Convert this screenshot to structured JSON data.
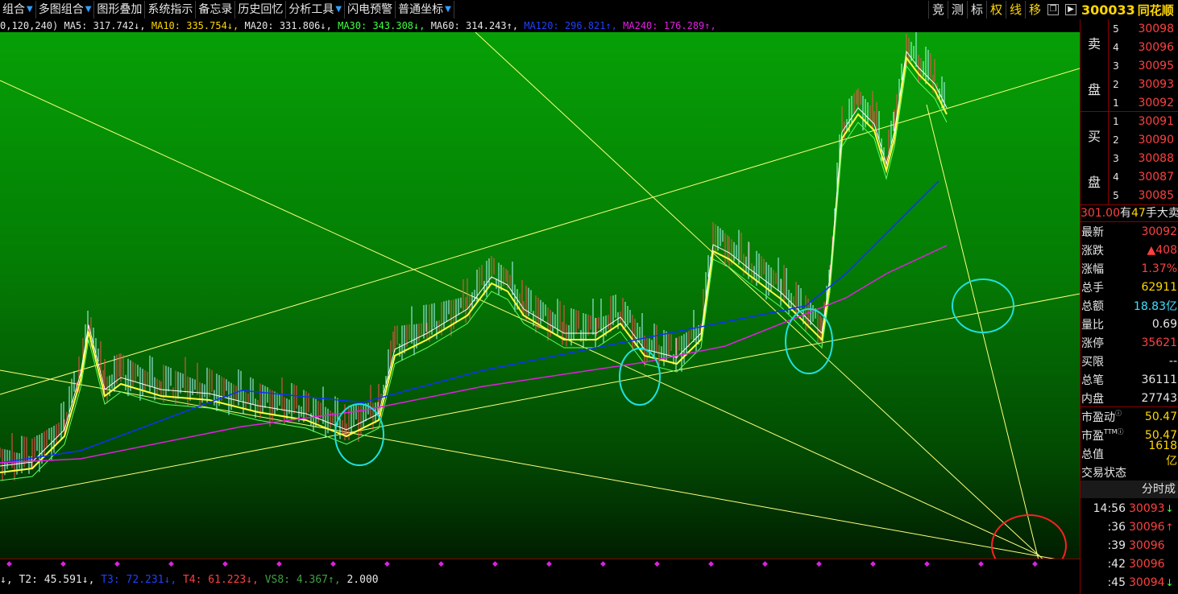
{
  "toolbar": {
    "items": [
      {
        "label": "组合",
        "arrow": "▼"
      },
      {
        "label": "多图组合",
        "arrow": "▼"
      },
      {
        "label": "图形叠加",
        "arrow": ""
      },
      {
        "label": "系统指示",
        "arrow": ""
      },
      {
        "label": "备忘录",
        "arrow": ""
      },
      {
        "label": "历史回忆",
        "arrow": ""
      },
      {
        "label": "分析工具",
        "arrow": "▼"
      },
      {
        "label": "闪电预警",
        "arrow": ""
      },
      {
        "label": "普通坐标",
        "arrow": "▼"
      }
    ],
    "right": [
      "竞",
      "测",
      "标",
      "权",
      "线",
      "移"
    ]
  },
  "stock": {
    "code": "300033",
    "name": "同花顺"
  },
  "ma_bar": {
    "prefix": "0,120,240)",
    "ma5": "MA5: 317.742↓,",
    "ma10": "MA10: 335.754↓,",
    "ma20": "MA20: 331.806↓,",
    "ma30": "MA30: 343.308↓,",
    "ma60": "MA60: 314.243↑,",
    "ma120": "MA120: 296.821↑,",
    "ma240": "MA240: 176.289↑,"
  },
  "indicator_bar": {
    "t1": "↓,",
    "t2": "T2: 45.591↓,",
    "t3": "T3: 72.231↓,",
    "t4": "T4: 61.223↓,",
    "vs8": "VS8: 4.367↑,",
    "v": "2.000"
  },
  "orderbook": {
    "sell_label": [
      "卖",
      "盘"
    ],
    "buy_label": [
      "买",
      "盘"
    ],
    "sell": [
      {
        "level": "5",
        "price": "30098"
      },
      {
        "level": "4",
        "price": "30096"
      },
      {
        "level": "3",
        "price": "30095"
      },
      {
        "level": "2",
        "price": "30093"
      },
      {
        "level": "1",
        "price": "30092"
      }
    ],
    "buy": [
      {
        "level": "1",
        "price": "30091"
      },
      {
        "level": "2",
        "price": "30090"
      },
      {
        "level": "3",
        "price": "30088"
      },
      {
        "level": "4",
        "price": "30087"
      },
      {
        "level": "5",
        "price": "30085"
      }
    ]
  },
  "message": {
    "price": "301.00",
    "text1": "有",
    "qty": "47",
    "text2": "手大卖"
  },
  "stats": [
    {
      "label": "最新",
      "value": "30092",
      "color": "red"
    },
    {
      "label": "涨跌",
      "value": "▲408",
      "color": "red"
    },
    {
      "label": "涨幅",
      "value": "1.37%",
      "color": "red"
    },
    {
      "label": "总手",
      "value": "62911",
      "color": "yel"
    },
    {
      "label": "总额",
      "value": "18.83亿",
      "color": "cyn"
    },
    {
      "label": "量比",
      "value": "0.69",
      "color": "wht"
    },
    {
      "label": "涨停",
      "value": "35621",
      "color": "red"
    },
    {
      "label": "买限",
      "value": "--",
      "color": "wht"
    },
    {
      "label": "总笔",
      "value": "36111",
      "color": "wht"
    },
    {
      "label": "内盘",
      "value": "27743",
      "color": "wht"
    }
  ],
  "stats2": [
    {
      "label": "市盈动",
      "sup": "ⓘ",
      "value": "50.47",
      "color": "yel"
    },
    {
      "label": "市盈",
      "sup": "TTMⓘ",
      "value": "50.47",
      "color": "yel"
    },
    {
      "label": "总值",
      "sup": "",
      "value": "1618亿",
      "color": "yel"
    },
    {
      "label": "交易状态",
      "sup": "",
      "value": "",
      "color": "wht"
    }
  ],
  "fenshi": {
    "title": "分时成",
    "rows": [
      {
        "time": "14:56",
        "price": "30093",
        "arrow": "↓",
        "acolor": "#40ff40"
      },
      {
        "time": ":36",
        "price": "30096",
        "arrow": "↑",
        "acolor": "#ff4040"
      },
      {
        "time": ":39",
        "price": "30096",
        "arrow": "",
        "acolor": "#ff4040"
      },
      {
        "time": ":42",
        "price": "30096",
        "arrow": "",
        "acolor": "#ff4040"
      },
      {
        "time": ":45",
        "price": "30094",
        "arrow": "↓",
        "acolor": "#40ff40"
      }
    ]
  }
}
